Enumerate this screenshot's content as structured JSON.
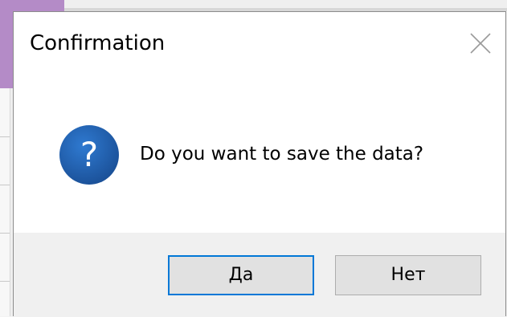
{
  "dialog": {
    "title": "Confirmation",
    "message": "Do you want to save the data?",
    "buttons": {
      "yes_label": "Да",
      "no_label": "Нет"
    }
  },
  "icons": {
    "close": "close-icon",
    "question": "question-icon"
  },
  "colors": {
    "accent": "#0078d7",
    "question_icon_bg": "#1f5fae",
    "background_app_strip": "#b48bc7",
    "button_area": "#f0f0f0"
  }
}
